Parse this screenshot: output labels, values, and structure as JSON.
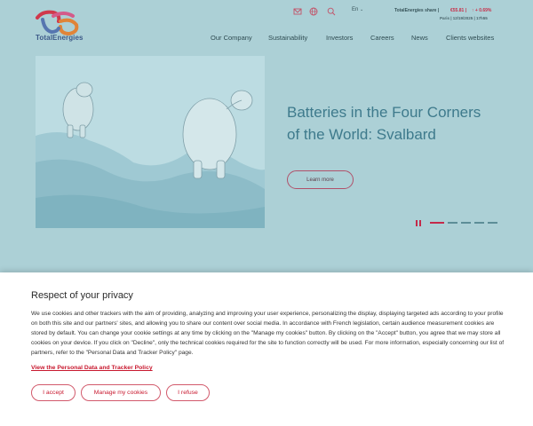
{
  "header": {
    "logo_text": "TotalEnergies",
    "icons": [
      "mail-icon",
      "globe-icon",
      "search-icon"
    ],
    "language": "En",
    "share_label": "TotalEnergies share |",
    "share_value": "€55.81 |",
    "share_change": "↑ + 0.69%",
    "share_sub": "Paris | 12/19/2025 | 17h55"
  },
  "nav": {
    "items": [
      "Our Company",
      "Sustainability",
      "Investors",
      "Careers",
      "News",
      "Clients websites"
    ]
  },
  "hero": {
    "title": "Batteries in the Four Corners of the World: Svalbard",
    "button": "Learn more",
    "slides_total": 5,
    "slide_active": 1
  },
  "cookie": {
    "title": "Respect of your privacy",
    "body": "We use cookies and other trackers with the aim of providing, analyzing and improving your user experience, personalizing the display, displaying targeted ads according to your profile on both this site and our partners' sites, and allowing you to share our content over social media. In accordance with French legislation, certain audience measurement cookies are stored by default. You can change your cookie settings at any time by clicking on the \"Manage my cookies\" button. By clicking on the \"Accept\" button, you agree that we may store all cookies on your device. If you click on \"Decline\", only the technical cookies required for the site to function correctly will be used. For more information, especially concerning our list of partners, refer to the \"Personal Data and Tracker Policy\" page.",
    "link": "View the Personal Data and Tracker Policy",
    "accept": "I accept",
    "manage": "Manage my cookies",
    "refuse": "I refuse"
  },
  "colors": {
    "overlay_bg": "#acd0d6",
    "accent": "#c8182e",
    "hero_title": "#3e7a8c"
  }
}
